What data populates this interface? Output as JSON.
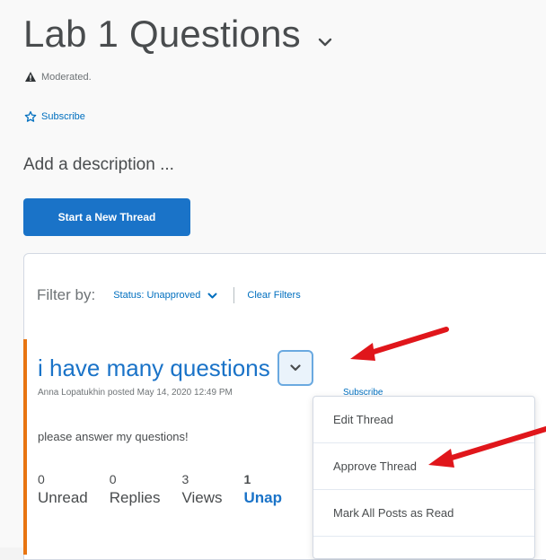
{
  "topic": {
    "title": "Lab 1 Questions",
    "moderated": "Moderated.",
    "subscribe": "Subscribe",
    "description_placeholder": "Add a description ..."
  },
  "actions": {
    "start_thread": "Start a New Thread"
  },
  "filter": {
    "label": "Filter by:",
    "status": "Status: Unapproved",
    "clear": "Clear Filters"
  },
  "thread": {
    "title": "i have many questions",
    "meta": "Anna Lopatukhin posted May 14, 2020 12:49 PM",
    "subscribe": "Subscribe",
    "body": "please answer my questions!",
    "stats": [
      {
        "value": "0",
        "label": "Unread"
      },
      {
        "value": "0",
        "label": "Replies"
      },
      {
        "value": "3",
        "label": "Views"
      },
      {
        "value": "1",
        "label": "Unap"
      }
    ]
  },
  "menu": {
    "items": [
      "Edit Thread",
      "Approve Thread",
      "Mark All Posts as Read"
    ]
  },
  "colors": {
    "link": "#006fbf",
    "primary": "#1a73c8",
    "accent_bar": "#e87511",
    "annotation_arrow": "#e0161b"
  }
}
